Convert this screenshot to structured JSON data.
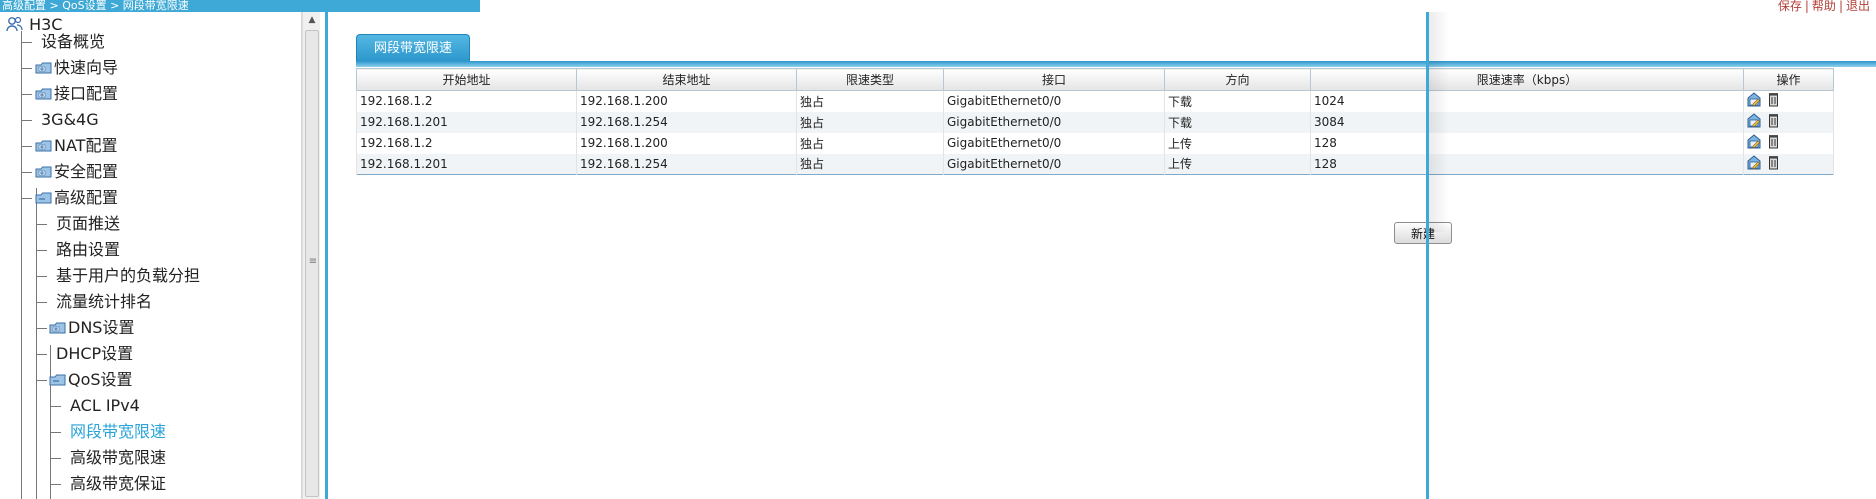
{
  "breadcrumb": "高级配置 > QoS设置 > 网段带宽限速",
  "top_links": [
    "保存",
    "帮助",
    "退出"
  ],
  "sidebar": {
    "root": "H3C",
    "items": [
      {
        "label": "设备概览"
      },
      {
        "label": "快速向导"
      },
      {
        "label": "接口配置"
      },
      {
        "label": "3G&4G"
      },
      {
        "label": "NAT配置"
      },
      {
        "label": "安全配置"
      },
      {
        "label": "高级配置"
      },
      {
        "label": "页面推送"
      },
      {
        "label": "路由设置"
      },
      {
        "label": "基于用户的负载分担"
      },
      {
        "label": "流量统计排名"
      },
      {
        "label": "DNS设置"
      },
      {
        "label": "DHCP设置"
      },
      {
        "label": "QoS设置"
      },
      {
        "label": "ACL IPv4"
      },
      {
        "label": "网段带宽限速"
      },
      {
        "label": "高级带宽限速"
      },
      {
        "label": "高级带宽保证"
      }
    ]
  },
  "main": {
    "tab_label": "网段带宽限速",
    "columns": [
      "开始地址",
      "结束地址",
      "限速类型",
      "接口",
      "方向",
      "限速速率（kbps）",
      "操作"
    ],
    "rows": [
      [
        "192.168.1.2",
        "192.168.1.200",
        "独占",
        "GigabitEthernet0/0",
        "下载",
        "1024"
      ],
      [
        "192.168.1.201",
        "192.168.1.254",
        "独占",
        "GigabitEthernet0/0",
        "下载",
        "3084"
      ],
      [
        "192.168.1.2",
        "192.168.1.200",
        "独占",
        "GigabitEthernet0/0",
        "上传",
        "128"
      ],
      [
        "192.168.1.201",
        "192.168.1.254",
        "独占",
        "GigabitEthernet0/0",
        "上传",
        "128"
      ]
    ],
    "new_button": "新建"
  },
  "colors": {
    "accent": "#3ea9d6",
    "active_item": "#2aa3d8",
    "top_link": "#b5403a"
  }
}
